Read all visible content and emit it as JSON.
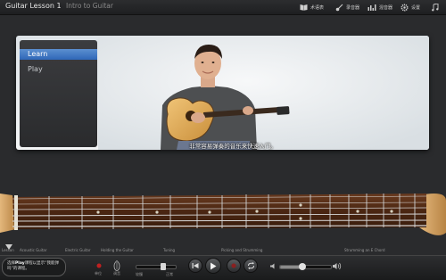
{
  "app": {
    "title": "Guitar Lesson 1",
    "subtitle": "Intro to Guitar"
  },
  "toolbar": {
    "items": [
      {
        "icon": "book-icon",
        "label": "术语表"
      },
      {
        "icon": "guitar-icon",
        "label": "录音器"
      },
      {
        "icon": "chart-icon",
        "label": "混音器"
      },
      {
        "icon": "gear-icon",
        "label": "设置"
      },
      {
        "icon": "music-note-icon",
        "label": ""
      }
    ]
  },
  "menu": {
    "items": [
      {
        "label": "Learn",
        "active": true
      },
      {
        "label": "Play",
        "active": false
      }
    ]
  },
  "video": {
    "subtitle": "非常容易弹奏的音乐来快速入门。"
  },
  "lessons": [
    "Lesson",
    "Acoustic Guitar",
    "Electric Guitar",
    "Holding the Guitar",
    "Tuning",
    "Picking and Strumming",
    "Strumming an E Chord"
  ],
  "bottom": {
    "hint_prefix": "选择",
    "hint_bold": "Play",
    "hint_rest": "课程以显示“我能弹吗”的课程。",
    "record_label": "单位",
    "tuner_label": "调音",
    "speed_slow": "较慢",
    "speed_normal": "正常",
    "speed_fraction": 0.7,
    "volume_fraction": 0.42
  },
  "colors": {
    "accent": "#3a78c9",
    "panel_bg": "#e9edf0"
  }
}
